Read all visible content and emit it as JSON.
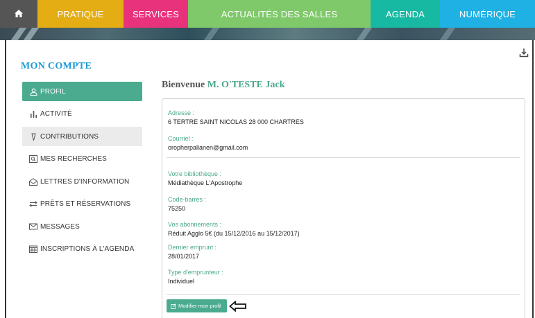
{
  "nav": {
    "items": [
      {
        "label": ""
      },
      {
        "label": "PRATIQUE"
      },
      {
        "label": "SERVICES"
      },
      {
        "label": "ACTUALITÉS DES SALLES"
      },
      {
        "label": "AGENDA"
      },
      {
        "label": "NUMÉRIQUE"
      }
    ],
    "home_icon": "home-icon"
  },
  "page": {
    "title": "MON COMPTE"
  },
  "sidebar": {
    "items": [
      {
        "label": "PROFIL",
        "icon": "user-icon",
        "active": true
      },
      {
        "label": "ACTIVITÉ",
        "icon": "bar-chart-icon"
      },
      {
        "label": "CONTRIBUTIONS",
        "icon": "pen-icon"
      },
      {
        "label": "MES RECHERCHES",
        "icon": "saved-search-icon"
      },
      {
        "label": "LETTRES D'INFORMATION",
        "icon": "envelope-open-icon"
      },
      {
        "label": "PRÊTS ET RÉSERVATIONS",
        "icon": "exchange-icon"
      },
      {
        "label": "MESSAGES",
        "icon": "envelope-icon"
      },
      {
        "label": "INSCRIPTIONS À L'AGENDA",
        "icon": "calendar-icon"
      }
    ]
  },
  "main": {
    "welcome_prefix": "Bienvenue",
    "welcome_name": "M. O'TESTE Jack",
    "fields": {
      "address": {
        "label": "Adresse :",
        "value": "6 TERTRE SAINT NICOLAS 28 000 CHARTRES"
      },
      "email": {
        "label": "Courriel :",
        "value": "oropherpallanen@gmail.com"
      },
      "library": {
        "label": "Votre bibliothèque :",
        "value": "Médiathèque L'Apostrophe"
      },
      "barcode": {
        "label": "Code-barres :",
        "value": "75250"
      },
      "subscriptions": {
        "label": "Vos abonnements :",
        "value": "Réduit Agglo 5€ (du 15/12/2016 au 15/12/2017)"
      },
      "last_loan": {
        "label": "Dernier emprunt :",
        "value": "28/01/2017"
      },
      "borrower_type": {
        "label": "Type d'emprunteur :",
        "value": "Individuel"
      }
    },
    "edit_button": "Modifier mon profil"
  },
  "colors": {
    "accent_green": "#4aab8f",
    "title_blue": "#1d9ad6",
    "nav_pratique": "#e5ad14",
    "nav_services": "#e8327c",
    "nav_actus": "#7fc96a",
    "nav_agenda": "#18b9a2",
    "nav_numerique": "#1fb1e3"
  },
  "icons": {
    "download": "download-icon",
    "annotation_arrow": "arrow-left-icon"
  }
}
